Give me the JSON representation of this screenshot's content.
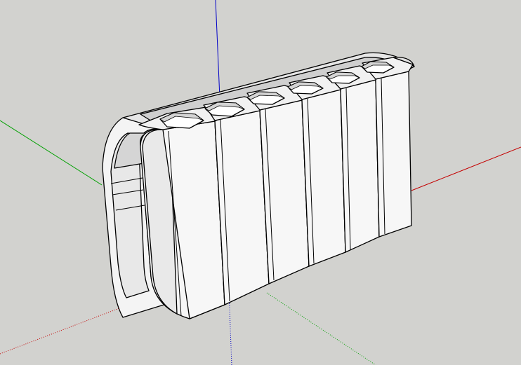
{
  "scene": {
    "background_color": "#d2d2cf",
    "axes": {
      "red_axis_color": "#c40000",
      "green_axis_color": "#00a000",
      "blue_axis_color": "#0000c8"
    },
    "model": {
      "name_hint": "hexagonal-socket-holder",
      "socket_count": 6,
      "face_light": "#f7f7f7",
      "face_mid": "#ececec",
      "face_shadow": "#d9d9d9",
      "edge_color": "#000000"
    }
  }
}
